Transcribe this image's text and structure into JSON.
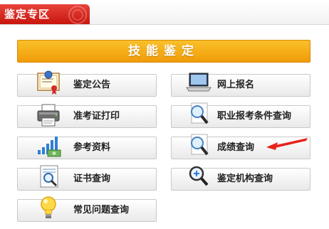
{
  "tab": {
    "title": "鉴定专区"
  },
  "banner": {
    "title": "技能鉴定"
  },
  "left_buttons": [
    {
      "label": "鉴定公告",
      "icon": "certificate-icon"
    },
    {
      "label": "准考证打印",
      "icon": "printer-icon"
    },
    {
      "label": "参考资料",
      "icon": "bar-chart-money-icon"
    },
    {
      "label": "证书查询",
      "icon": "document-search-icon"
    },
    {
      "label": "常见问题查询",
      "icon": "lightbulb-icon"
    }
  ],
  "right_buttons": [
    {
      "label": "网上报名",
      "icon": "laptop-icon"
    },
    {
      "label": "职业报考条件查询",
      "icon": "magnifier-icon"
    },
    {
      "label": "成绩查询",
      "icon": "magnifier-icon"
    },
    {
      "label": "鉴定机构查询",
      "icon": "magnifier-plus-icon"
    }
  ],
  "colors": {
    "tab_red": "#d8201a",
    "banner_orange": "#f3a712",
    "arrow_red": "#e8231d"
  }
}
